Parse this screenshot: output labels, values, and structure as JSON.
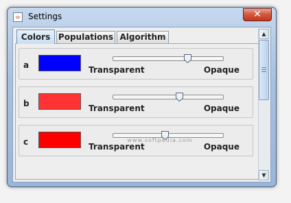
{
  "window": {
    "title": "Settings",
    "close_glyph": "✕",
    "app_icon_glyph": "☕"
  },
  "tabs": [
    {
      "label": "Colors",
      "active": true
    },
    {
      "label": "Populations",
      "active": false
    },
    {
      "label": "Algorithm",
      "active": false
    }
  ],
  "rows": [
    {
      "label": "a",
      "color": "#0000ff",
      "opacity_fraction": 0.69,
      "transparent_label": "Transparent",
      "opaque_label": "Opaque"
    },
    {
      "label": "b",
      "color": "#ff3333",
      "opacity_fraction": 0.61,
      "transparent_label": "Transparent",
      "opaque_label": "Opaque"
    },
    {
      "label": "c",
      "color": "#ff0000",
      "opacity_fraction": 0.47,
      "transparent_label": "Transparent",
      "opaque_label": "Opaque"
    }
  ],
  "watermark": "www.softpedia.com",
  "icons": {
    "scroll_up": "▲",
    "scroll_down": "▼"
  }
}
